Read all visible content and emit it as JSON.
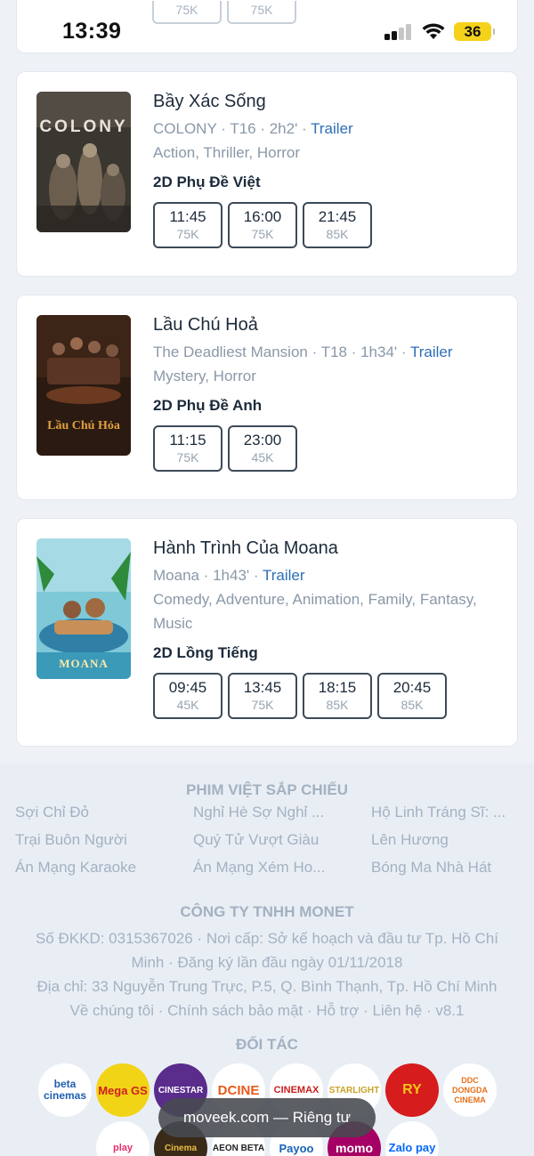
{
  "status_bar": {
    "time": "13:39",
    "battery": "36"
  },
  "top_card": {
    "prices": [
      "75K",
      "75K"
    ]
  },
  "movies": [
    {
      "title": "Bầy Xác Sống",
      "original_title": "COLONY",
      "rating": "T16",
      "duration": "2h2'",
      "trailer": "Trailer",
      "genres": "Action, Thriller, Horror",
      "format": "2D Phụ Đề Việt",
      "poster_text": "COLONY",
      "showtimes": [
        {
          "time": "11:45",
          "price": "75K"
        },
        {
          "time": "16:00",
          "price": "75K"
        },
        {
          "time": "21:45",
          "price": "85K"
        }
      ]
    },
    {
      "title": "Lầu Chú Hoả",
      "original_title": "The Deadliest Mansion",
      "rating": "T18",
      "duration": "1h34'",
      "trailer": "Trailer",
      "genres": "Mystery, Horror",
      "format": "2D Phụ Đề Anh",
      "poster_text": "Lầu Chú Hỏa",
      "showtimes": [
        {
          "time": "11:15",
          "price": "75K"
        },
        {
          "time": "23:00",
          "price": "45K"
        }
      ]
    },
    {
      "title": "Hành Trình Của Moana",
      "original_title": "Moana",
      "duration": "1h43'",
      "trailer": "Trailer",
      "genres": "Comedy, Adventure, Animation, Family, Fantasy, Music",
      "format": "2D Lồng Tiếng",
      "poster_text": "MOANA",
      "showtimes": [
        {
          "time": "09:45",
          "price": "45K"
        },
        {
          "time": "13:45",
          "price": "75K"
        },
        {
          "time": "18:15",
          "price": "85K"
        },
        {
          "time": "20:45",
          "price": "85K"
        }
      ]
    }
  ],
  "footer": {
    "upcoming_title": "PHIM VIỆT SẮP CHIẾU",
    "upcoming": [
      "Sợi Chỉ Đỏ",
      "Nghỉ Hè Sợ Nghỉ ...",
      "Hộ Linh Tráng Sĩ: ...",
      "Trại Buôn Người",
      "Quý Tử Vượt Giàu",
      "Lên Hương",
      "Án Mạng Karaoke",
      "Án Mạng Xém Ho...",
      "Bóng Ma Nhà Hát"
    ],
    "company_title": "CÔNG TY TNHH MONET",
    "registration": "Số ĐKKD: 0315367026 · Nơi cấp: Sở kế hoạch và đầu tư Tp. Hồ Chí Minh · Đăng ký lần đầu ngày 01/11/2018",
    "address": "Địa chỉ: 33 Nguyễn Trung Trực, P.5, Q. Bình Thạnh, Tp. Hồ Chí Minh",
    "links": [
      "Về chúng tôi",
      "Chính sách bảo mật",
      "Hỗ trợ",
      "Liên hệ",
      "v8.1"
    ],
    "partners_title": "ĐỐI TÁC",
    "partners": [
      "beta cinemas",
      "Mega GS",
      "CINESTAR",
      "DCINE",
      "CINEMAX",
      "STARLIGHT",
      "RY",
      "DDC DONGDA CINEMA",
      "play",
      "Cinema",
      "AEON BETA",
      "Payoo",
      "momo",
      "Zalo pay"
    ]
  },
  "browser": {
    "url_pill": "moveek.com — Riêng tư"
  }
}
